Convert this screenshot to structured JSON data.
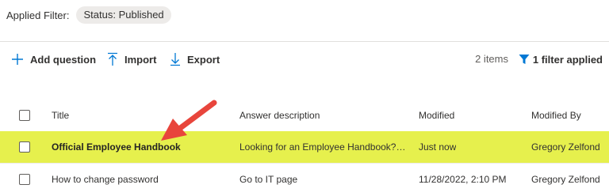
{
  "filter": {
    "label": "Applied Filter:",
    "pill": "Status: Published"
  },
  "command_bar": {
    "add_label": "Add question",
    "import_label": "Import",
    "export_label": "Export",
    "items_count": "2 items",
    "filter_applied": "1 filter applied"
  },
  "table": {
    "columns": [
      "Title",
      "Answer description",
      "Modified",
      "Modified By"
    ],
    "rows": [
      {
        "title": "Official Employee Handbook",
        "answer": "Looking for an Employee Handbook? Y...",
        "modified": "Just now",
        "modified_by": "Gregory Zelfond",
        "highlighted": true
      },
      {
        "title": "How to change password",
        "answer": "Go to IT page",
        "modified": "11/28/2022, 2:10 PM",
        "modified_by": "Gregory Zelfond",
        "highlighted": false
      }
    ]
  },
  "colors": {
    "accent": "#0078d4",
    "highlight": "#e6f04d",
    "annotation_arrow": "#e8453c"
  },
  "icons": [
    "add-icon",
    "import-icon",
    "export-icon",
    "filter-icon",
    "annotation-arrow"
  ]
}
